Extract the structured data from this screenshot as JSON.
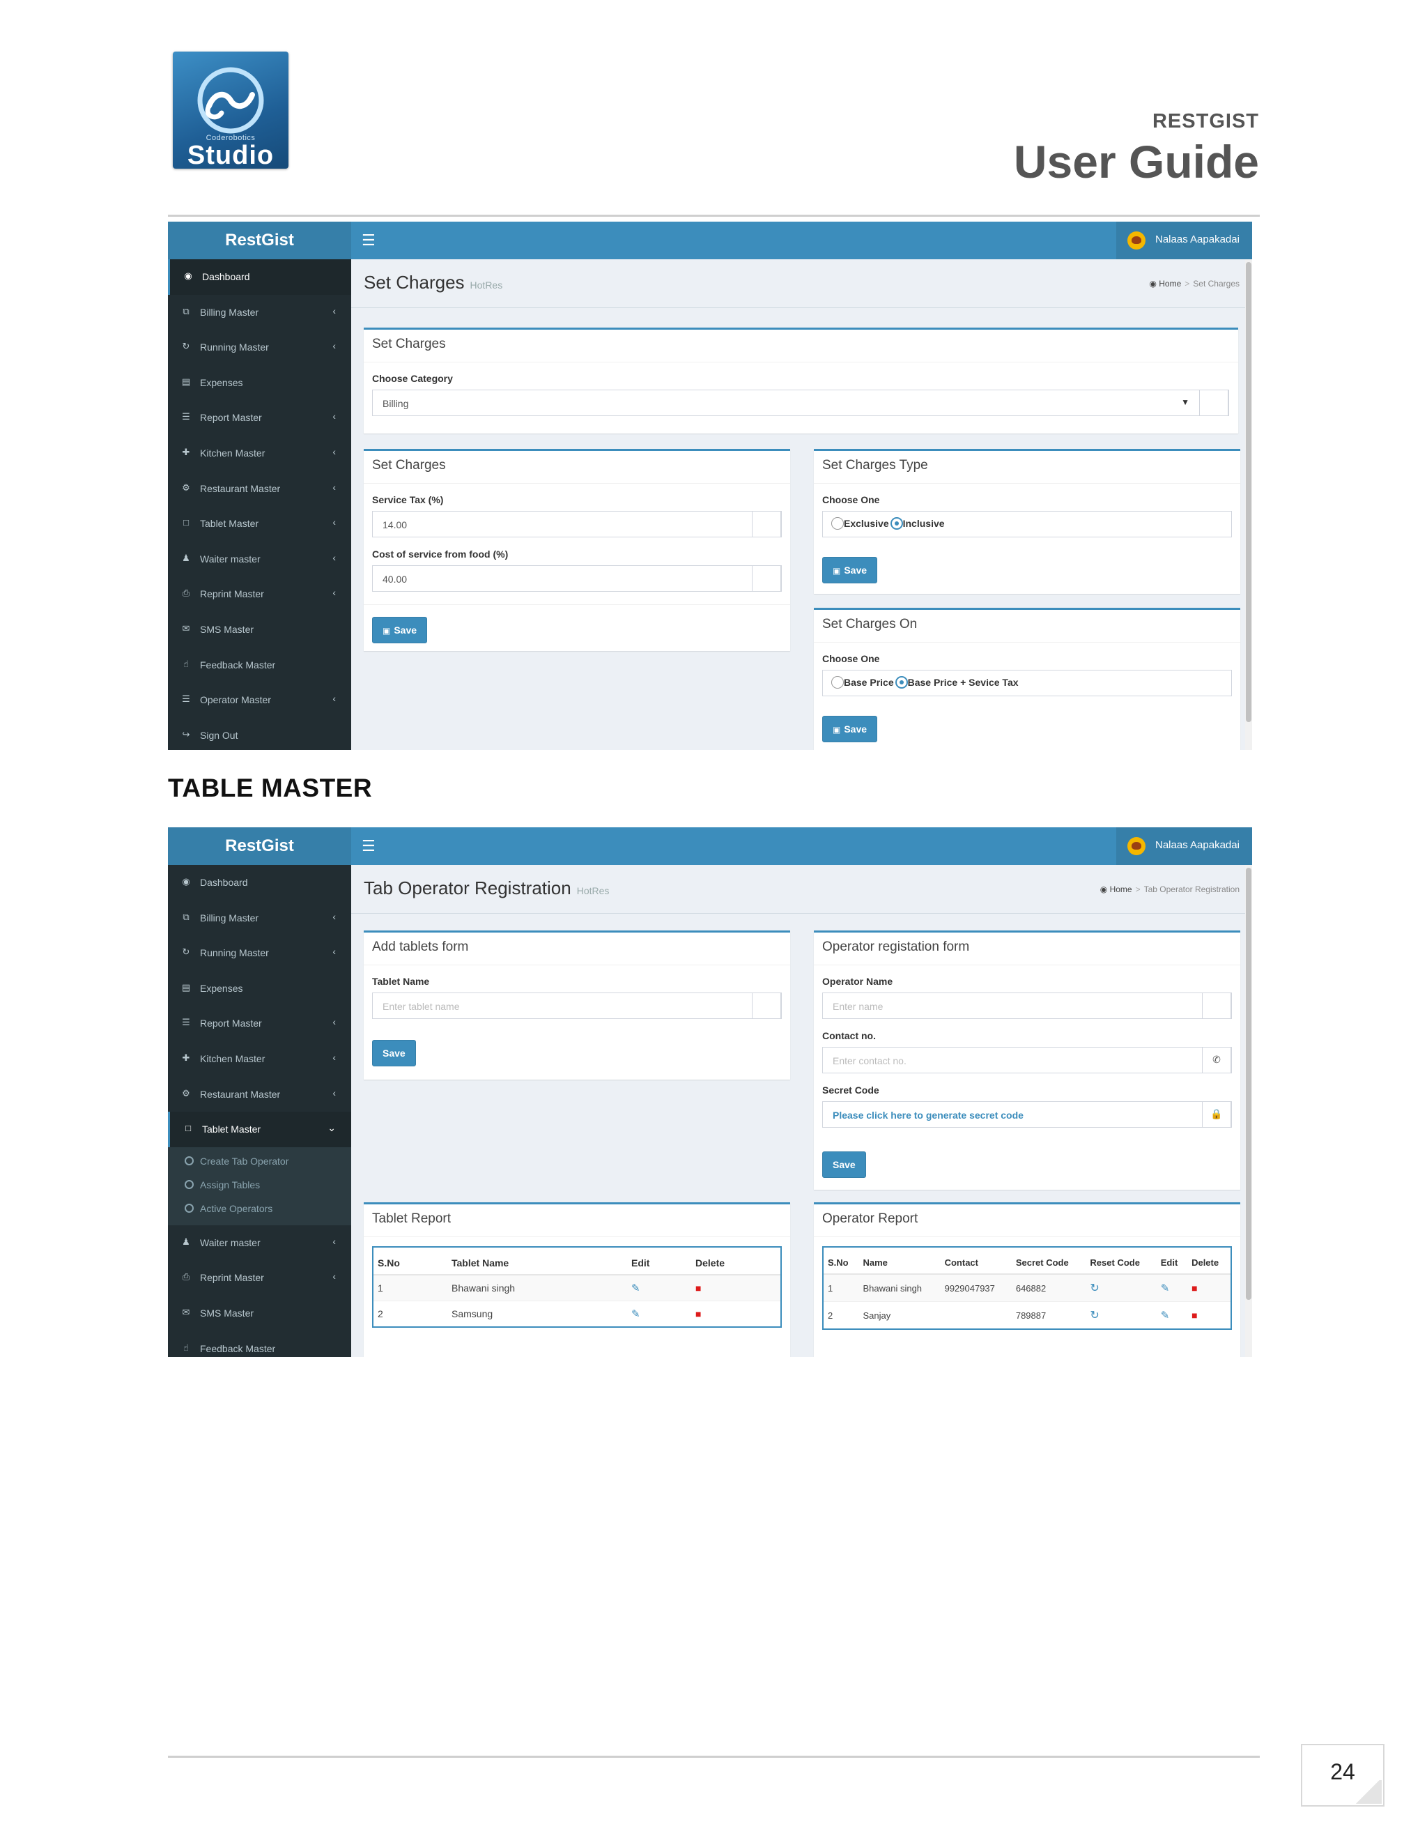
{
  "document": {
    "logo_small_text": "Coderobotics",
    "logo_word": "Studio",
    "title_small": "RESTGIST",
    "title_big": "User Guide",
    "section_heading": "TABLE MASTER",
    "page_number": "24"
  },
  "app": {
    "brand": "RestGist",
    "user_name": "Nalaas Aapakadai",
    "colors": {
      "header": "#3c8dbc",
      "sidebar": "#222d32",
      "primary": "#3c8dbc",
      "danger": "#dd1b1b"
    }
  },
  "screen1": {
    "page_title": "Set Charges",
    "page_subtitle": "HotRes",
    "breadcrumb": {
      "home": "Home",
      "current": "Set Charges"
    },
    "sidebar": [
      {
        "label": "Dashboard",
        "icon": "dashboard-icon"
      },
      {
        "label": "Billing Master",
        "icon": "copy-icon"
      },
      {
        "label": "Running Master",
        "icon": "refresh-icon"
      },
      {
        "label": "Expenses",
        "icon": "money-icon"
      },
      {
        "label": "Report Master",
        "icon": "list-icon"
      },
      {
        "label": "Kitchen Master",
        "icon": "cutlery-icon"
      },
      {
        "label": "Restaurant Master",
        "icon": "cogs-icon"
      },
      {
        "label": "Tablet Master",
        "icon": "tablet-icon"
      },
      {
        "label": "Waiter master",
        "icon": "user-icon"
      },
      {
        "label": "Reprint Master",
        "icon": "print-icon"
      },
      {
        "label": "SMS Master",
        "icon": "envelope-icon"
      },
      {
        "label": "Feedback Master",
        "icon": "thumbs-icon"
      },
      {
        "label": "Operator Master",
        "icon": "list-alt-icon"
      },
      {
        "label": "Sign Out",
        "icon": "sign-out-icon"
      }
    ],
    "category_box": {
      "title": "Set Charges",
      "label": "Choose Category",
      "value": "Billing"
    },
    "charges_box": {
      "title": "Set Charges",
      "service_tax_label": "Service Tax (%)",
      "service_tax_value": "14.00",
      "food_cost_label": "Cost of service from food (%)",
      "food_cost_value": "40.00",
      "save": "Save"
    },
    "type_box": {
      "title": "Set Charges Type",
      "label": "Choose One",
      "option1": "Exclusive",
      "option2": "Inclusive",
      "selected": "Inclusive",
      "save": "Save"
    },
    "on_box": {
      "title": "Set Charges On",
      "label": "Choose One",
      "option1": "Base Price",
      "option2": "Base Price + Sevice Tax",
      "selected": "Base Price + Sevice Tax",
      "save": "Save"
    }
  },
  "screen2": {
    "page_title": "Tab Operator Registration",
    "page_subtitle": "HotRes",
    "breadcrumb": {
      "home": "Home",
      "current": "Tab Operator Registration"
    },
    "sidebar_top": [
      {
        "label": "Dashboard",
        "icon": "dashboard-icon"
      },
      {
        "label": "Billing Master",
        "icon": "copy-icon"
      },
      {
        "label": "Running Master",
        "icon": "refresh-icon"
      },
      {
        "label": "Expenses",
        "icon": "money-icon"
      },
      {
        "label": "Report Master",
        "icon": "list-icon"
      },
      {
        "label": "Kitchen Master",
        "icon": "cutlery-icon"
      },
      {
        "label": "Restaurant Master",
        "icon": "cogs-icon"
      },
      {
        "label": "Tablet Master",
        "icon": "tablet-icon"
      }
    ],
    "submenu": [
      "Create Tab Operator",
      "Assign Tables",
      "Active Operators"
    ],
    "sidebar_bottom": [
      {
        "label": "Waiter master",
        "icon": "user-icon"
      },
      {
        "label": "Reprint Master",
        "icon": "print-icon"
      },
      {
        "label": "SMS Master",
        "icon": "envelope-icon"
      },
      {
        "label": "Feedback Master",
        "icon": "thumbs-icon"
      }
    ],
    "tablet_form": {
      "title": "Add tablets form",
      "label": "Tablet Name",
      "placeholder": "Enter tablet name",
      "save": "Save"
    },
    "operator_form": {
      "title": "Operator registation form",
      "name_label": "Operator Name",
      "name_placeholder": "Enter name",
      "contact_label": "Contact no.",
      "contact_placeholder": "Enter contact no.",
      "secret_label": "Secret Code",
      "secret_link": "Please click here to generate secret code",
      "save": "Save"
    },
    "tablet_report": {
      "title": "Tablet Report",
      "columns": [
        "S.No",
        "Tablet Name",
        "Edit",
        "Delete"
      ],
      "rows": [
        {
          "sno": "1",
          "name": "Bhawani singh"
        },
        {
          "sno": "2",
          "name": "Samsung"
        }
      ]
    },
    "operator_report": {
      "title": "Operator Report",
      "columns": [
        "S.No",
        "Name",
        "Contact",
        "Secret Code",
        "Reset Code",
        "Edit",
        "Delete"
      ],
      "rows": [
        {
          "sno": "1",
          "name": "Bhawani singh",
          "contact": "9929047937",
          "code": "646882"
        },
        {
          "sno": "2",
          "name": "Sanjay",
          "contact": "",
          "code": "789887"
        }
      ]
    }
  }
}
